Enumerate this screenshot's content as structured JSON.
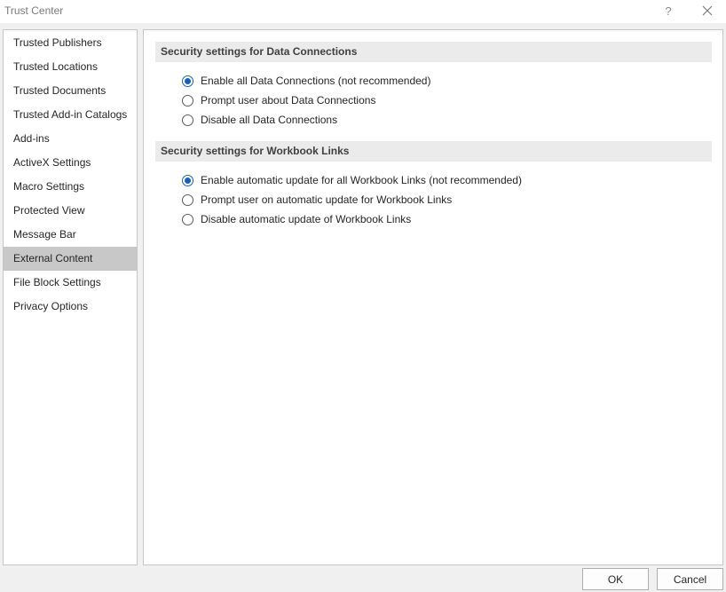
{
  "window": {
    "title": "Trust Center",
    "help_glyph": "?"
  },
  "sidebar": {
    "items": [
      {
        "label": "Trusted Publishers"
      },
      {
        "label": "Trusted Locations"
      },
      {
        "label": "Trusted Documents"
      },
      {
        "label": "Trusted Add-in Catalogs"
      },
      {
        "label": "Add-ins"
      },
      {
        "label": "ActiveX Settings"
      },
      {
        "label": "Macro Settings"
      },
      {
        "label": "Protected View"
      },
      {
        "label": "Message Bar"
      },
      {
        "label": "External Content",
        "selected": true
      },
      {
        "label": "File Block Settings"
      },
      {
        "label": "Privacy Options"
      }
    ]
  },
  "data_connections": {
    "header": "Security settings for Data Connections",
    "options": [
      {
        "label": "Enable all Data Connections (not recommended)",
        "checked": true
      },
      {
        "label": "Prompt user about Data Connections",
        "checked": false
      },
      {
        "label": "Disable all Data Connections",
        "checked": false
      }
    ]
  },
  "workbook_links": {
    "header": "Security settings for Workbook Links",
    "options": [
      {
        "label": "Enable automatic update for all Workbook Links (not recommended)",
        "checked": true
      },
      {
        "label": "Prompt user on automatic update for Workbook Links",
        "checked": false
      },
      {
        "label": "Disable automatic update of Workbook Links",
        "checked": false
      }
    ]
  },
  "footer": {
    "ok_label": "OK",
    "cancel_label": "Cancel"
  },
  "icons": {
    "help": "help-icon",
    "close": "close-icon",
    "radio": "radio-button"
  },
  "colors": {
    "accent": "#1a5fb4",
    "selected_nav": "#c8c8c8",
    "section_header_bg": "#ebebeb"
  }
}
